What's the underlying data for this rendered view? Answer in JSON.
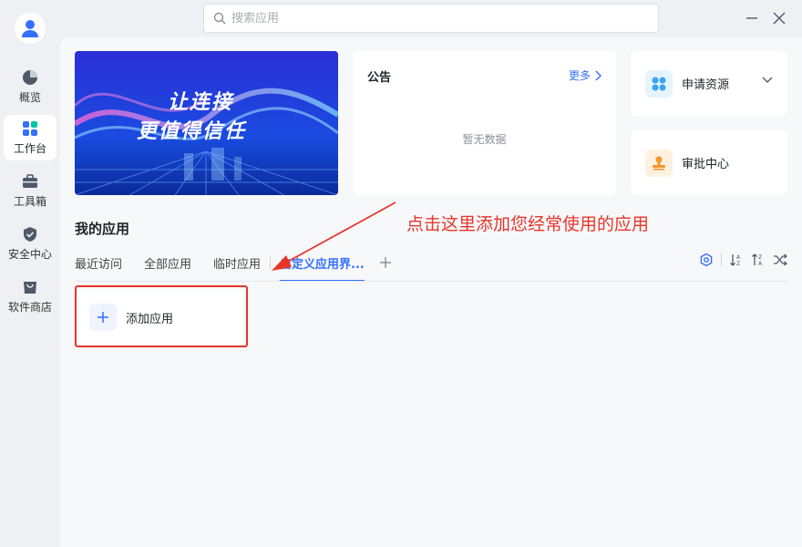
{
  "search": {
    "placeholder": "搜索应用"
  },
  "sidebar": {
    "items": [
      {
        "label": "概览",
        "icon": "pie-chart-icon"
      },
      {
        "label": "工作台",
        "icon": "apps-grid-icon",
        "active": true
      },
      {
        "label": "工具箱",
        "icon": "toolbox-icon"
      },
      {
        "label": "安全中心",
        "icon": "shield-icon"
      },
      {
        "label": "软件商店",
        "icon": "store-icon"
      }
    ]
  },
  "banner": {
    "line1": "让连接",
    "line2": "更值得信任"
  },
  "notice": {
    "title": "公告",
    "more": "更多",
    "empty": "暂无数据"
  },
  "quick_actions": [
    {
      "label": "申请资源",
      "icon": "resource-apply-icon"
    },
    {
      "label": "审批中心",
      "icon": "approval-stamp-icon"
    }
  ],
  "my_apps": {
    "title": "我的应用",
    "tabs": [
      "最近访问",
      "全部应用",
      "临时应用",
      "自定义应用界..."
    ],
    "active_tab": 3,
    "add_app_label": "添加应用"
  },
  "annotation": {
    "text": "点击这里添加您经常使用的应用"
  },
  "colors": {
    "accent": "#3370ff",
    "annotation": "#e8352a"
  }
}
